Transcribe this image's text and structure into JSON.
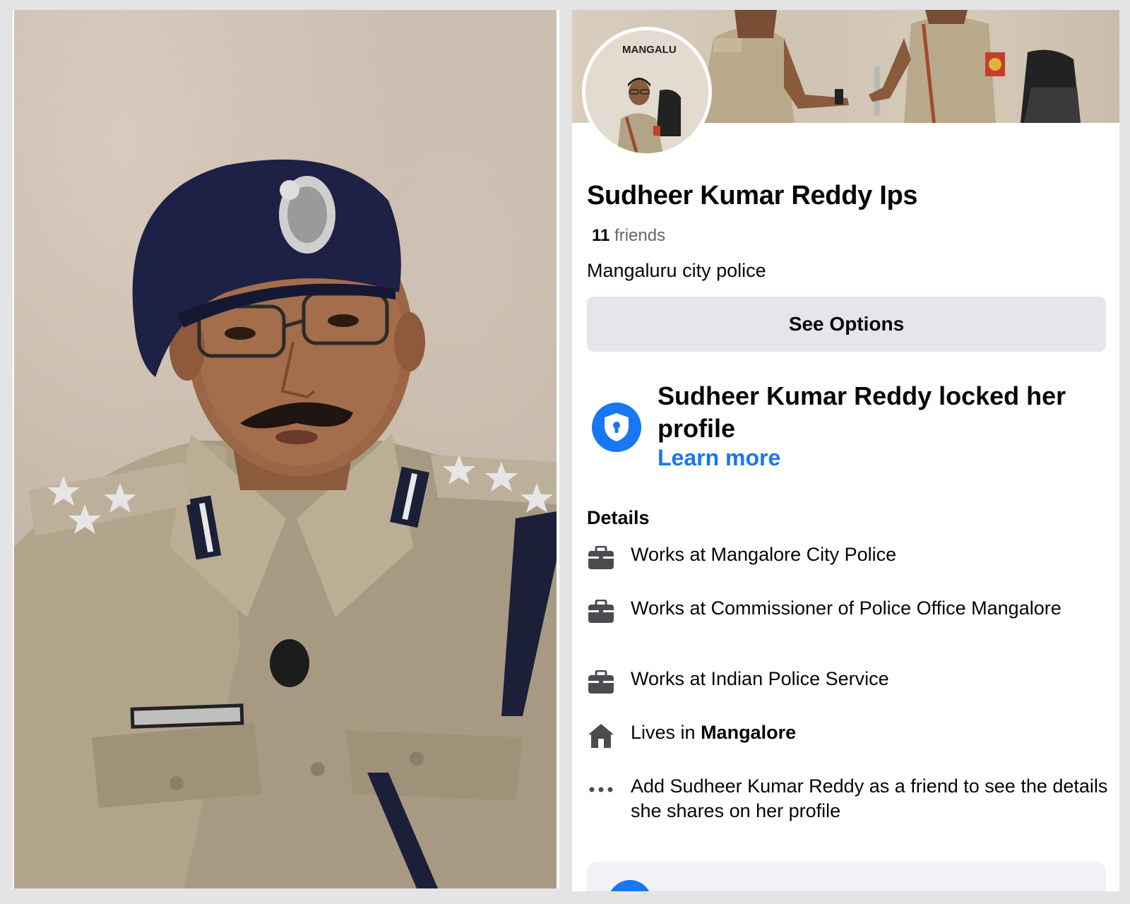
{
  "profile": {
    "name": "Sudheer Kumar Reddy Ips",
    "friends_count": "11",
    "friends_label": "friends",
    "bio": "Mangaluru city police",
    "see_options_label": "See Options",
    "cover_sign_text": "MANGALU"
  },
  "lock_notice": {
    "title": "Sudheer Kumar Reddy locked her profile",
    "learn_more": "Learn more"
  },
  "details": {
    "heading": "Details",
    "items": [
      {
        "icon": "briefcase-icon",
        "text": "Works at Mangalore City Police"
      },
      {
        "icon": "briefcase-icon",
        "text": "Works at Commissioner of Police Office Mangalore"
      },
      {
        "icon": "briefcase-icon",
        "text": "Works at Indian Police Service"
      },
      {
        "icon": "home-icon",
        "prefix": "Lives in ",
        "bold": "Mangalore"
      },
      {
        "icon": "more-dots-icon",
        "text": "Add Sudheer Kumar Reddy as a friend to see the details she shares on her profile"
      }
    ]
  },
  "colors": {
    "accent": "#1877f2",
    "button_bg": "#e4e6eb",
    "text_primary": "#050505",
    "text_secondary": "#65676b"
  }
}
